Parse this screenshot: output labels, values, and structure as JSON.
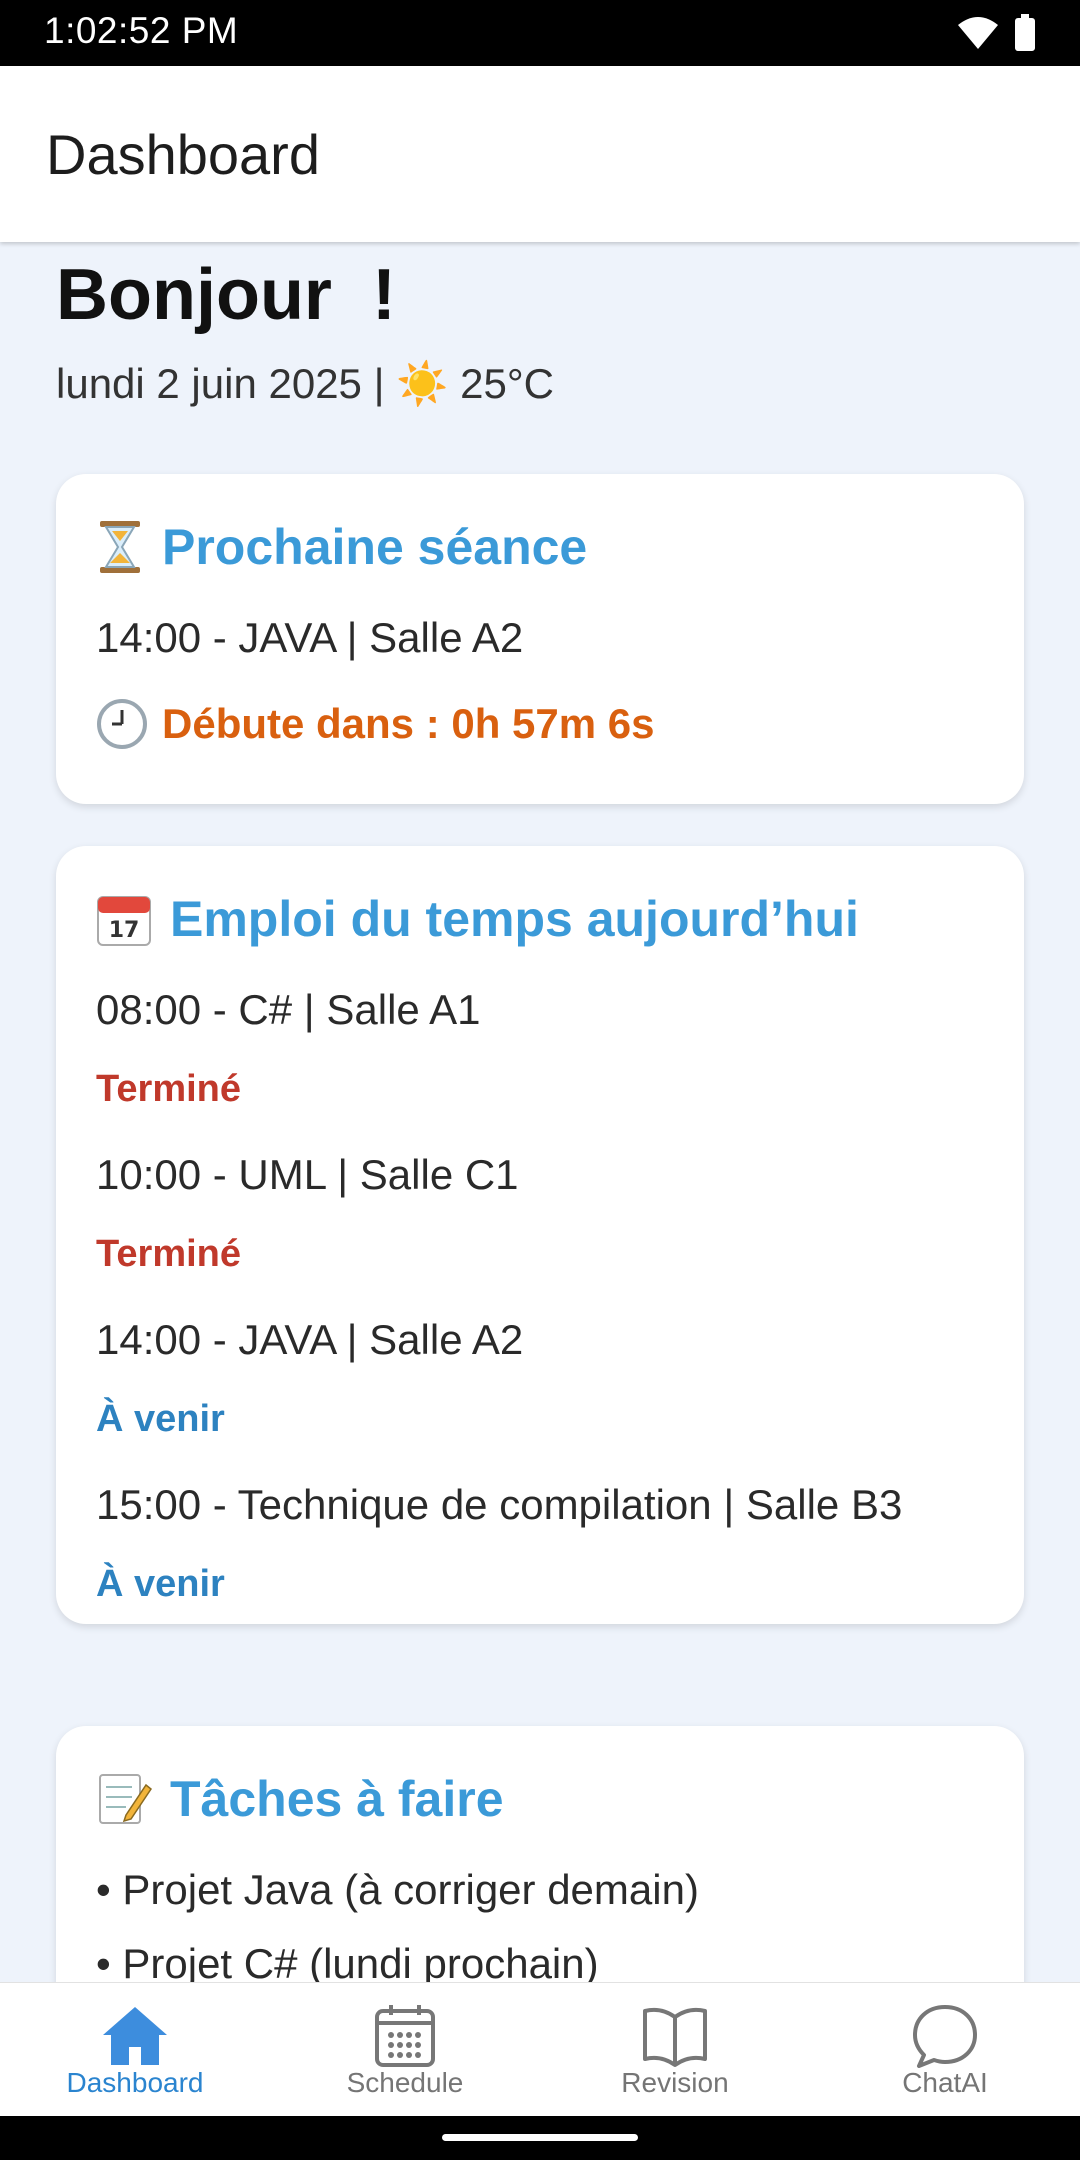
{
  "status_bar": {
    "time": "1:02:52 PM"
  },
  "app_bar": {
    "title": "Dashboard"
  },
  "greeting": "Bonjour  !",
  "date_weather": "lundi 2 juin 2025 | ☀️ 25°C",
  "next_session": {
    "icon": "hourglass-icon",
    "title": "Prochaine séance",
    "detail": "14:00 - JAVA | Salle A2",
    "countdown_icon": "clock-icon",
    "countdown": "Débute dans : 0h 57m 6s"
  },
  "schedule": {
    "icon": "calendar-icon",
    "title": "Emploi du temps aujourd’hui",
    "items": [
      {
        "line": "08:00 - C# | Salle A1",
        "status": "Terminé"
      },
      {
        "line": "10:00 - UML | Salle C1",
        "status": "Terminé"
      },
      {
        "line": "14:00 - JAVA | Salle A2",
        "status": "À venir"
      },
      {
        "line": "15:00 - Technique de compilation | Salle B3",
        "status": "À venir"
      }
    ]
  },
  "tasks": {
    "icon": "memo-icon",
    "title": "Tâches à faire",
    "items": [
      "• Projet Java (à corriger demain)",
      "• Projet C# (lundi prochain)"
    ]
  },
  "bottom_nav": [
    {
      "label": "Dashboard",
      "icon": "home-icon",
      "active": true
    },
    {
      "label": "Schedule",
      "icon": "calendar-grid-icon",
      "active": false
    },
    {
      "label": "Revision",
      "icon": "book-icon",
      "active": false
    },
    {
      "label": "ChatAI",
      "icon": "chat-bubble-icon",
      "active": false
    }
  ],
  "colors": {
    "accent": "#3b9ad8",
    "countdown": "#d9600f",
    "done": "#c0392b",
    "upcoming": "#2d82c0",
    "background": "#eef3fb"
  }
}
